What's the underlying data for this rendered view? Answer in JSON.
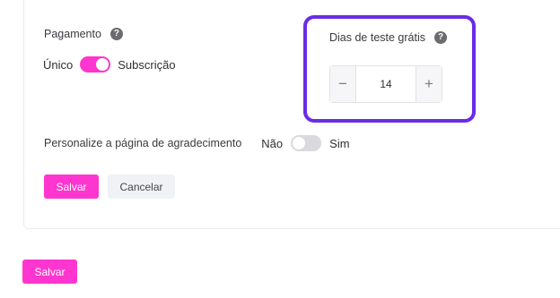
{
  "payment": {
    "label": "Pagamento",
    "option_left": "Único",
    "option_right": "Subscrição",
    "toggle_on": true
  },
  "trial": {
    "label": "Dias de teste grátis",
    "value": "14",
    "minus": "−",
    "plus": "+"
  },
  "thank_you_page": {
    "label": "Personalize a página de agradecimento",
    "option_no": "Não",
    "option_yes": "Sim",
    "toggle_on": false
  },
  "form_actions": {
    "save_label": "Salvar",
    "cancel_label": "Cancelar"
  },
  "page_actions": {
    "save_label": "Salvar"
  },
  "colors": {
    "accent": "#ff35cf",
    "highlight_border": "#6a2ce6"
  },
  "icons": {
    "help": "?"
  }
}
